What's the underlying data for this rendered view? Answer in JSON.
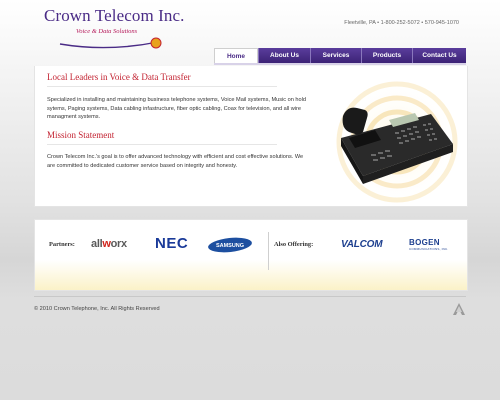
{
  "brand": {
    "title": "Crown Telecom Inc.",
    "tagline": "Voice & Data Solutions",
    "contact": "Fleetville, PA • 1-800-252-5072 • 570-945-1070"
  },
  "nav": {
    "tabs": [
      {
        "label": "Home",
        "active": true
      },
      {
        "label": "About Us",
        "active": false
      },
      {
        "label": "Services",
        "active": false
      },
      {
        "label": "Products",
        "active": false
      },
      {
        "label": "Contact Us",
        "active": false
      }
    ]
  },
  "main": {
    "heading1": "Local Leaders in Voice & Data Transfer",
    "paragraph1": "Specialized in installing and maintaining business telephone systems, Voice Mail systems, Music on hold sytems, Paging systems, Data cabling infastructure, fiber optic cabling, Coax for television, and all wire managment systems.",
    "heading2": "Mission Statement",
    "paragraph2": "Crown Telecom Inc.'s goal is to offer advanced technology with efficient and cost effective solutions. We are committed to dedicated customer service based on integrity and honesty."
  },
  "partners": {
    "partners_label": "Partners:",
    "also_label": "Also Offering:",
    "logos": {
      "allworx_prefix": "all",
      "allworx_x": "w",
      "allworx_suffix": "orx",
      "nec": "NEC",
      "samsung": "SAMSUNG",
      "valcom": "VALCOM",
      "bogen": "BOGEN",
      "bogen_sub": "COMMUNICATIONS, INC."
    }
  },
  "footer": {
    "copyright": "© 2010 Crown Telephone, Inc. All Rights Reserved"
  },
  "colors": {
    "brand_purple": "#4a2b86",
    "accent_red": "#c32231",
    "tagline_pink": "#b5195a",
    "partner_blue": "#1d3f8f"
  }
}
